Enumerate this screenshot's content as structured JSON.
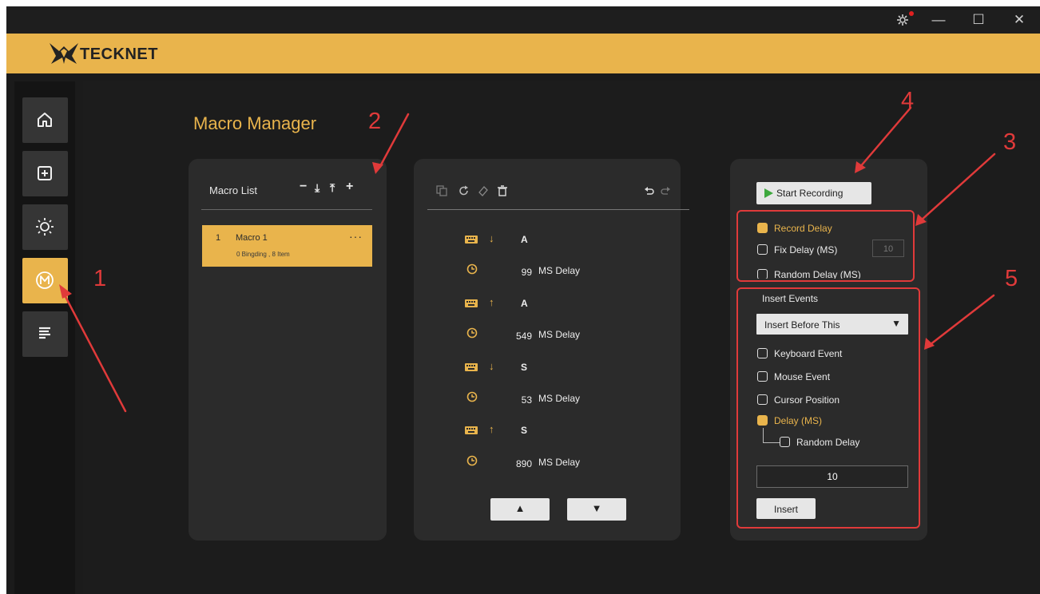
{
  "window": {
    "settings_icon": "gear-icon",
    "minimize_label": "—",
    "maximize_label": "☐",
    "close_label": "✕",
    "colors": {
      "accent": "#e9b44c",
      "dark": "#1b1b1b",
      "annotation": "#e03a3a"
    }
  },
  "brand": {
    "name": "TECKNET"
  },
  "sidebar": {
    "items": [
      {
        "icon": "home-icon"
      },
      {
        "icon": "plus-square-icon"
      },
      {
        "icon": "sun-icon"
      },
      {
        "icon": "macro-icon",
        "active": true
      },
      {
        "icon": "document-icon"
      }
    ]
  },
  "page": {
    "title": "Macro Manager"
  },
  "macro_list": {
    "title": "Macro List",
    "controls": {
      "remove": "−",
      "import": "⤓",
      "export": "⤒",
      "add": "+"
    },
    "items": [
      {
        "index": "1",
        "name": "Macro 1",
        "menu": "···",
        "info": "0 Bingding , 8 Item"
      }
    ]
  },
  "events": {
    "toolbar": [
      "copy-icon",
      "refresh-icon",
      "eraser-icon",
      "trash-icon",
      "undo-icon",
      "redo-icon"
    ],
    "rows": [
      {
        "type": "key",
        "direction": "↓",
        "key": "A"
      },
      {
        "type": "delay",
        "value": "99",
        "unit": "MS Delay"
      },
      {
        "type": "key",
        "direction": "↑",
        "key": "A"
      },
      {
        "type": "delay",
        "value": "549",
        "unit": "MS Delay"
      },
      {
        "type": "key",
        "direction": "↓",
        "key": "S"
      },
      {
        "type": "delay",
        "value": "53",
        "unit": "MS Delay"
      },
      {
        "type": "key",
        "direction": "↑",
        "key": "S"
      },
      {
        "type": "delay",
        "value": "890",
        "unit": "MS Delay"
      }
    ],
    "move_up": "▲",
    "move_down": "▼"
  },
  "recording": {
    "start_label": "Start Recording",
    "record_delay_label": "Record Delay",
    "fix_delay_label": "Fix Delay (MS)",
    "fix_delay_value": "10",
    "random_delay_label": "Random Delay (MS)"
  },
  "insert": {
    "title": "Insert Events",
    "position_selected": "Insert Before This",
    "options": {
      "keyboard": "Keyboard Event",
      "mouse": "Mouse Event",
      "cursor": "Cursor Position",
      "delay": "Delay (MS)",
      "random": "Random Delay"
    },
    "delay_value": "10",
    "button_label": "Insert"
  },
  "annotations": {
    "n1": "1",
    "n2": "2",
    "n3": "3",
    "n4": "4",
    "n5": "5"
  }
}
